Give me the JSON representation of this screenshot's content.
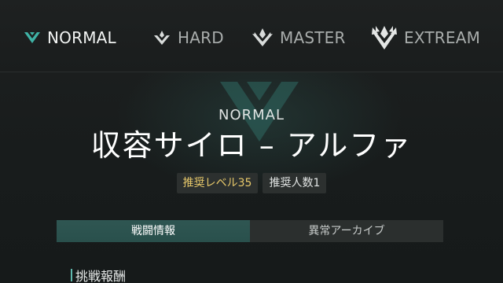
{
  "difficulty_tabs": [
    {
      "label": "NORMAL",
      "icon": "normal-rank-icon",
      "active": true
    },
    {
      "label": "HARD",
      "icon": "hard-rank-icon",
      "active": false
    },
    {
      "label": "MASTER",
      "icon": "master-rank-icon",
      "active": false
    },
    {
      "label": "EXTREAM",
      "icon": "extream-rank-icon",
      "active": false
    }
  ],
  "stage": {
    "difficulty": "NORMAL",
    "title": "収容サイロ – アルファ",
    "recommended_level": "推奨レベル35",
    "recommended_players": "推奨人数1"
  },
  "info_tabs": [
    {
      "label": "戦闘情報",
      "active": true
    },
    {
      "label": "異常アーカイブ",
      "active": false
    }
  ],
  "section": {
    "title": "挑戦報酬"
  },
  "colors": {
    "accent": "#3fb3a6",
    "level_text": "#e8c96a",
    "active_tab_bg": "#2f5652"
  }
}
